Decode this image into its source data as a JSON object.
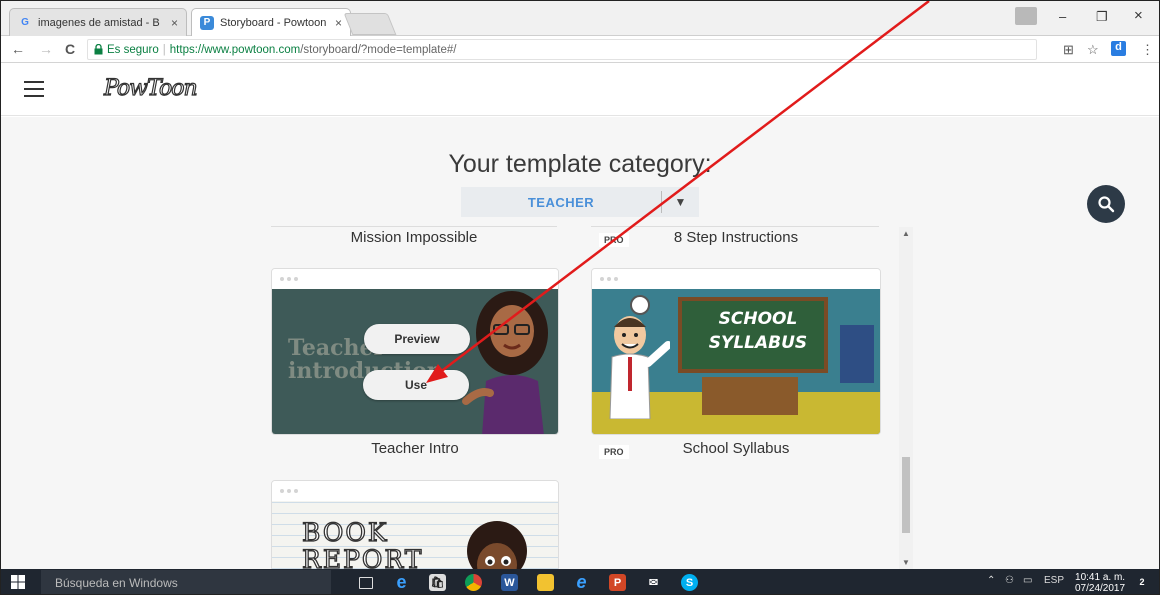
{
  "browser": {
    "tabs": [
      {
        "title": "imagenes de amistad - B",
        "favicon": "G",
        "close": "×"
      },
      {
        "title": "Storyboard - Powtoon",
        "favicon": "P",
        "close": "×"
      }
    ],
    "window_controls": {
      "minimize": "–",
      "maximize": "❐",
      "close": "×"
    },
    "nav": {
      "back": "←",
      "forward": "→",
      "reload": "C"
    },
    "address": {
      "secure_label": "Es seguro",
      "url_scheme_host": "https://www.powtoon.com",
      "url_path": "/storyboard/?mode=template#/"
    },
    "toolbar_icons": {
      "translate": "⊞",
      "star": "☆",
      "extension": "d",
      "menu": "⋮"
    }
  },
  "app": {
    "logo": "PowToon",
    "heading": "Your template category:",
    "category": {
      "selected": "TEACHER",
      "caret": "▼"
    }
  },
  "templates": {
    "top_row": [
      {
        "name": "Mission Impossible",
        "pro": ""
      },
      {
        "name": "8 Step Instructions",
        "pro": "PRO"
      }
    ],
    "cards": [
      {
        "name": "Teacher Intro",
        "pro": "",
        "thumb_text_line1": "Teacher",
        "thumb_text_line2": "introduction",
        "preview_label": "Preview",
        "use_label": "Use"
      },
      {
        "name": "School Syllabus",
        "pro": "PRO",
        "thumb_text_line1": "SCHOOL",
        "thumb_text_line2": "SYLLABUS"
      },
      {
        "name": "",
        "pro": "",
        "thumb_text_line1": "BOOK",
        "thumb_text_line2": "REPORT"
      }
    ]
  },
  "taskbar": {
    "search_placeholder": "Búsqueda en Windows",
    "language": "ESP",
    "time": "10:41 a. m.",
    "date": "07/24/2017",
    "notifications": "2"
  },
  "colors": {
    "accent_blue": "#4a90d9",
    "teacher_bg": "#3e5a58",
    "chalkboard": "#2f5f3a",
    "annotation_arrow": "#e11b1b"
  }
}
